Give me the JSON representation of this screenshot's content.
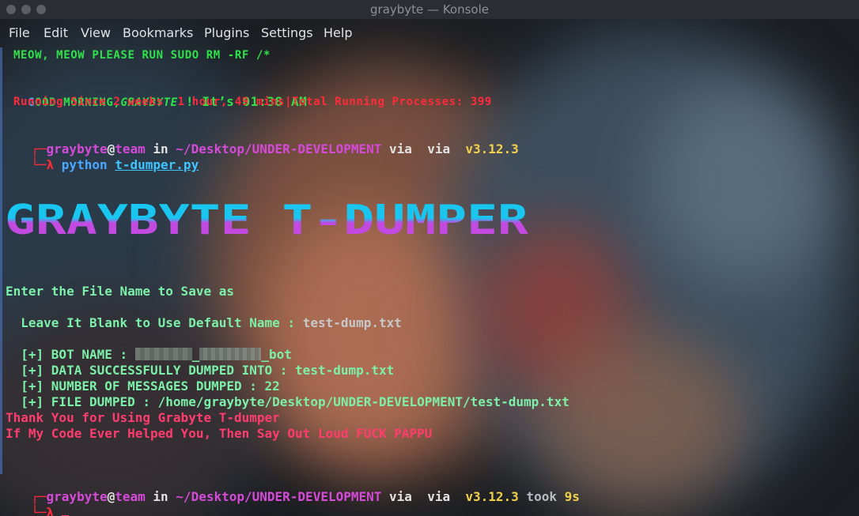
{
  "window": {
    "title": "graybyte — Konsole"
  },
  "menu": [
    "File",
    "Edit",
    "View",
    "Bookmarks",
    "Plugins",
    "Settings",
    "Help"
  ],
  "terminal": {
    "motd": "MEOW, MEOW PLEASE RUN SUDO RM -RF /*",
    "greeting_g": "G",
    "greeting_pre": "OOD MORNING,",
    "greeting_name": "GRAYBYTE",
    "greeting_post": " ! It’s 01:38 AM",
    "uptime": "Running Since 2 weeks  1 hour, 49 mins|Total Running Processes: 399",
    "prompt1": {
      "corner": "┌─",
      "user": "graybyte",
      "at": "@",
      "host": "team",
      "in": " in ",
      "path": "~/Desktop/UNDER-DEVELOPMENT",
      "via1": " via ",
      "glyph1": "",
      "via2": " via ",
      "glyph2": "",
      "version": " v3.12.3",
      "arrow": "└─λ ",
      "cmd": "python ",
      "arg": "t-dumper.py"
    },
    "banner": "GRAYBYTE T-DUMPER",
    "ask1": "Enter the File Name to Save as",
    "ask2_label": "Leave It Blank to Use Default Name : ",
    "ask2_value": "test-dump.txt",
    "results": {
      "bot_label": "[+] BOT NAME : ",
      "bot_mid": "_",
      "bot_suffix": "_bot",
      "dumped_label": "[+] DATA SUCCESSFULLY DUMPED INTO : ",
      "dumped_value": "test-dump.txt",
      "count_label": "[+] NUMBER OF MESSAGES DUMPED : ",
      "count_value": "22",
      "file_label": "[+] FILE DUMPED : ",
      "file_value": "/home/graybyte/Desktop/UNDER-DEVELOPMENT/test-dump.txt"
    },
    "thanks": "Thank You for Using Grabyte T-dumper",
    "shout": "If My Code Ever Helped You, Then Say Out Loud FUCK PAPPU",
    "prompt2": {
      "took": " took ",
      "duration": "9s",
      "arrow": "└─λ "
    }
  },
  "colors": {
    "accent_green": "#2fe14a",
    "accent_red": "#ff2a3a",
    "banner_top": "#19c6f0",
    "banner_bottom": "#c24ae0"
  }
}
